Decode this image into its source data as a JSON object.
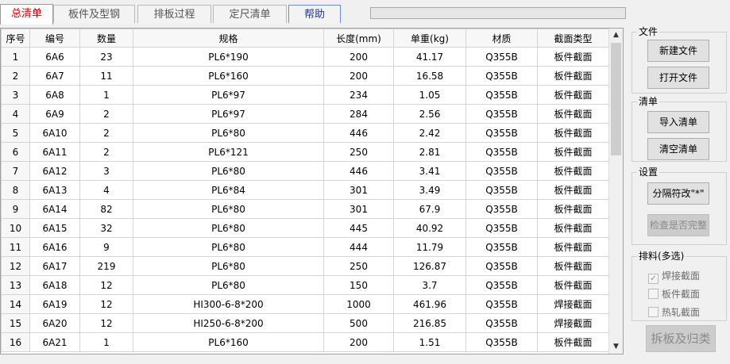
{
  "tabs": [
    {
      "label": "总清单",
      "active": true
    },
    {
      "label": "板件及型钢",
      "active": false
    },
    {
      "label": "排板过程",
      "active": false
    },
    {
      "label": "定尺清单",
      "active": false
    },
    {
      "label": "帮助",
      "active": false
    }
  ],
  "progress": {
    "value": 0
  },
  "table": {
    "headers": [
      "序号",
      "编号",
      "数量",
      "规格",
      "长度(mm)",
      "单重(kg)",
      "材质",
      "截面类型"
    ],
    "rows": [
      [
        "1",
        "6A6",
        "23",
        "PL6*190",
        "200",
        "41.17",
        "Q355B",
        "板件截面"
      ],
      [
        "2",
        "6A7",
        "11",
        "PL6*160",
        "200",
        "16.58",
        "Q355B",
        "板件截面"
      ],
      [
        "3",
        "6A8",
        "1",
        "PL6*97",
        "234",
        "1.05",
        "Q355B",
        "板件截面"
      ],
      [
        "4",
        "6A9",
        "2",
        "PL6*97",
        "284",
        "2.56",
        "Q355B",
        "板件截面"
      ],
      [
        "5",
        "6A10",
        "2",
        "PL6*80",
        "446",
        "2.42",
        "Q355B",
        "板件截面"
      ],
      [
        "6",
        "6A11",
        "2",
        "PL6*121",
        "250",
        "2.81",
        "Q355B",
        "板件截面"
      ],
      [
        "7",
        "6A12",
        "3",
        "PL6*80",
        "446",
        "3.41",
        "Q355B",
        "板件截面"
      ],
      [
        "8",
        "6A13",
        "4",
        "PL6*84",
        "301",
        "3.49",
        "Q355B",
        "板件截面"
      ],
      [
        "9",
        "6A14",
        "82",
        "PL6*80",
        "301",
        "67.9",
        "Q355B",
        "板件截面"
      ],
      [
        "10",
        "6A15",
        "32",
        "PL6*80",
        "445",
        "40.92",
        "Q355B",
        "板件截面"
      ],
      [
        "11",
        "6A16",
        "9",
        "PL6*80",
        "444",
        "11.79",
        "Q355B",
        "板件截面"
      ],
      [
        "12",
        "6A17",
        "219",
        "PL6*80",
        "250",
        "126.87",
        "Q355B",
        "板件截面"
      ],
      [
        "13",
        "6A18",
        "12",
        "PL6*80",
        "150",
        "3.7",
        "Q355B",
        "板件截面"
      ],
      [
        "14",
        "6A19",
        "12",
        "HI300-6-8*200",
        "1000",
        "461.96",
        "Q355B",
        "焊接截面"
      ],
      [
        "15",
        "6A20",
        "12",
        "HI250-6-8*200",
        "500",
        "216.85",
        "Q355B",
        "焊接截面"
      ],
      [
        "16",
        "6A21",
        "1",
        "PL6*160",
        "200",
        "1.51",
        "Q355B",
        "板件截面"
      ]
    ]
  },
  "file_group": {
    "title": "文件",
    "new_file": "新建文件",
    "open_file": "打开文件"
  },
  "list_group": {
    "title": "清单",
    "import_list": "导入清单",
    "clear_list": "清空清单"
  },
  "settings_group": {
    "title": "设置",
    "separator": "分隔符改\"*\"",
    "check_complete": "检查是否完整"
  },
  "nesting_group": {
    "title": "排料(多选)",
    "options": [
      {
        "label": "焊接截面",
        "checked": true
      },
      {
        "label": "板件截面",
        "checked": false
      },
      {
        "label": "热轧截面",
        "checked": false
      }
    ]
  },
  "split_button": "拆板及归类",
  "colors": {
    "active_tab": "#cc0000",
    "help_tab": "#1a3a9a",
    "disabled": "#8a8a8a"
  },
  "icons": {
    "scroll_up": "▲",
    "scroll_down": "▼",
    "check": "✓"
  }
}
